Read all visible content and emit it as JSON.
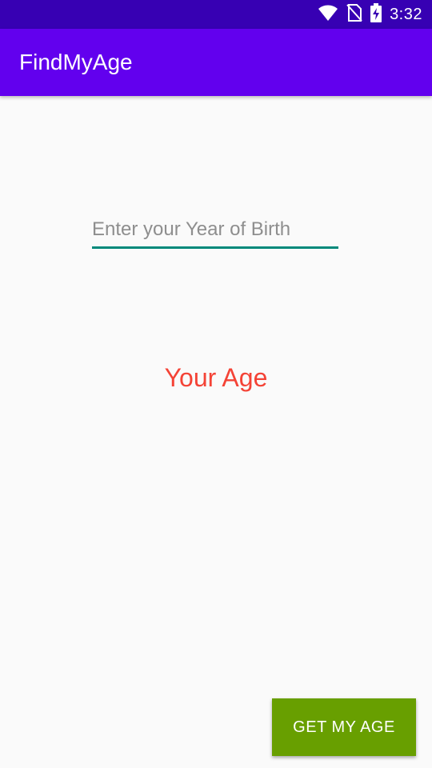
{
  "status_bar": {
    "time": "3:32",
    "icons": [
      "wifi-icon",
      "no-sim-icon",
      "battery-charging-icon"
    ]
  },
  "app_bar": {
    "title": "FindMyAge"
  },
  "form": {
    "year_input": {
      "placeholder": "Enter your Year of Birth",
      "value": ""
    },
    "age_label": "Your Age"
  },
  "actions": {
    "get_age_label": "GET MY AGE"
  },
  "colors": {
    "status_bar": "#3700B3",
    "app_bar": "#6200EE",
    "input_underline": "#00897B",
    "age_text": "#F44336",
    "button": "#689F00",
    "background": "#FAFAFA"
  }
}
